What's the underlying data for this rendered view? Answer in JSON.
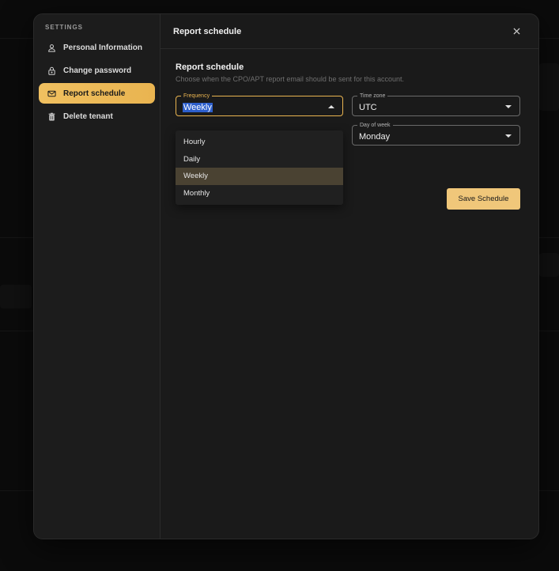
{
  "sidebar": {
    "heading": "SETTINGS",
    "items": [
      {
        "label": "Personal Information",
        "icon": "user-icon",
        "active": false
      },
      {
        "label": "Change password",
        "icon": "lock-icon",
        "active": false
      },
      {
        "label": "Report schedule",
        "icon": "mail-icon",
        "active": true
      },
      {
        "label": "Delete tenant",
        "icon": "trash-icon",
        "active": false
      }
    ]
  },
  "header": {
    "title": "Report schedule",
    "close_icon": "close-icon"
  },
  "section": {
    "title": "Report schedule",
    "description": "Choose when the CPO/APT report email should be sent for this account."
  },
  "fields": {
    "frequency": {
      "label": "Frequency",
      "value": "Weekly"
    },
    "timezone": {
      "label": "Time zone",
      "value": "UTC"
    },
    "day_of_week": {
      "label": "Day of week",
      "value": "Monday"
    }
  },
  "dropdown": {
    "options": [
      "Hourly",
      "Daily",
      "Weekly",
      "Monthly"
    ],
    "selected": "Weekly"
  },
  "actions": {
    "save_label": "Save Schedule"
  },
  "colors": {
    "accent": "#e9b450",
    "save_button": "#f0c77a",
    "selected_option": "#4a4232",
    "text_selection": "#2d5fcc"
  }
}
